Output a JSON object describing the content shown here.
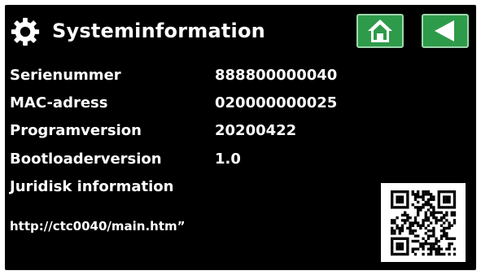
{
  "header": {
    "title": "Systeminformation",
    "settings_icon": "gear-icon",
    "home_icon": "home-icon",
    "back_icon": "back-arrow-icon",
    "accent_color": "#2e9b4a"
  },
  "info": [
    {
      "label": "Serienummer",
      "value": "888800000040"
    },
    {
      "label": "MAC-adress",
      "value": "020000000025"
    },
    {
      "label": "Programversion",
      "value": "20200422"
    },
    {
      "label": "Bootloaderversion",
      "value": "1.0"
    },
    {
      "label": "Juridisk information",
      "value": ""
    }
  ],
  "legal": {
    "url": "http://ctc0040/main.htm”",
    "qr_icon": "qr-code"
  }
}
